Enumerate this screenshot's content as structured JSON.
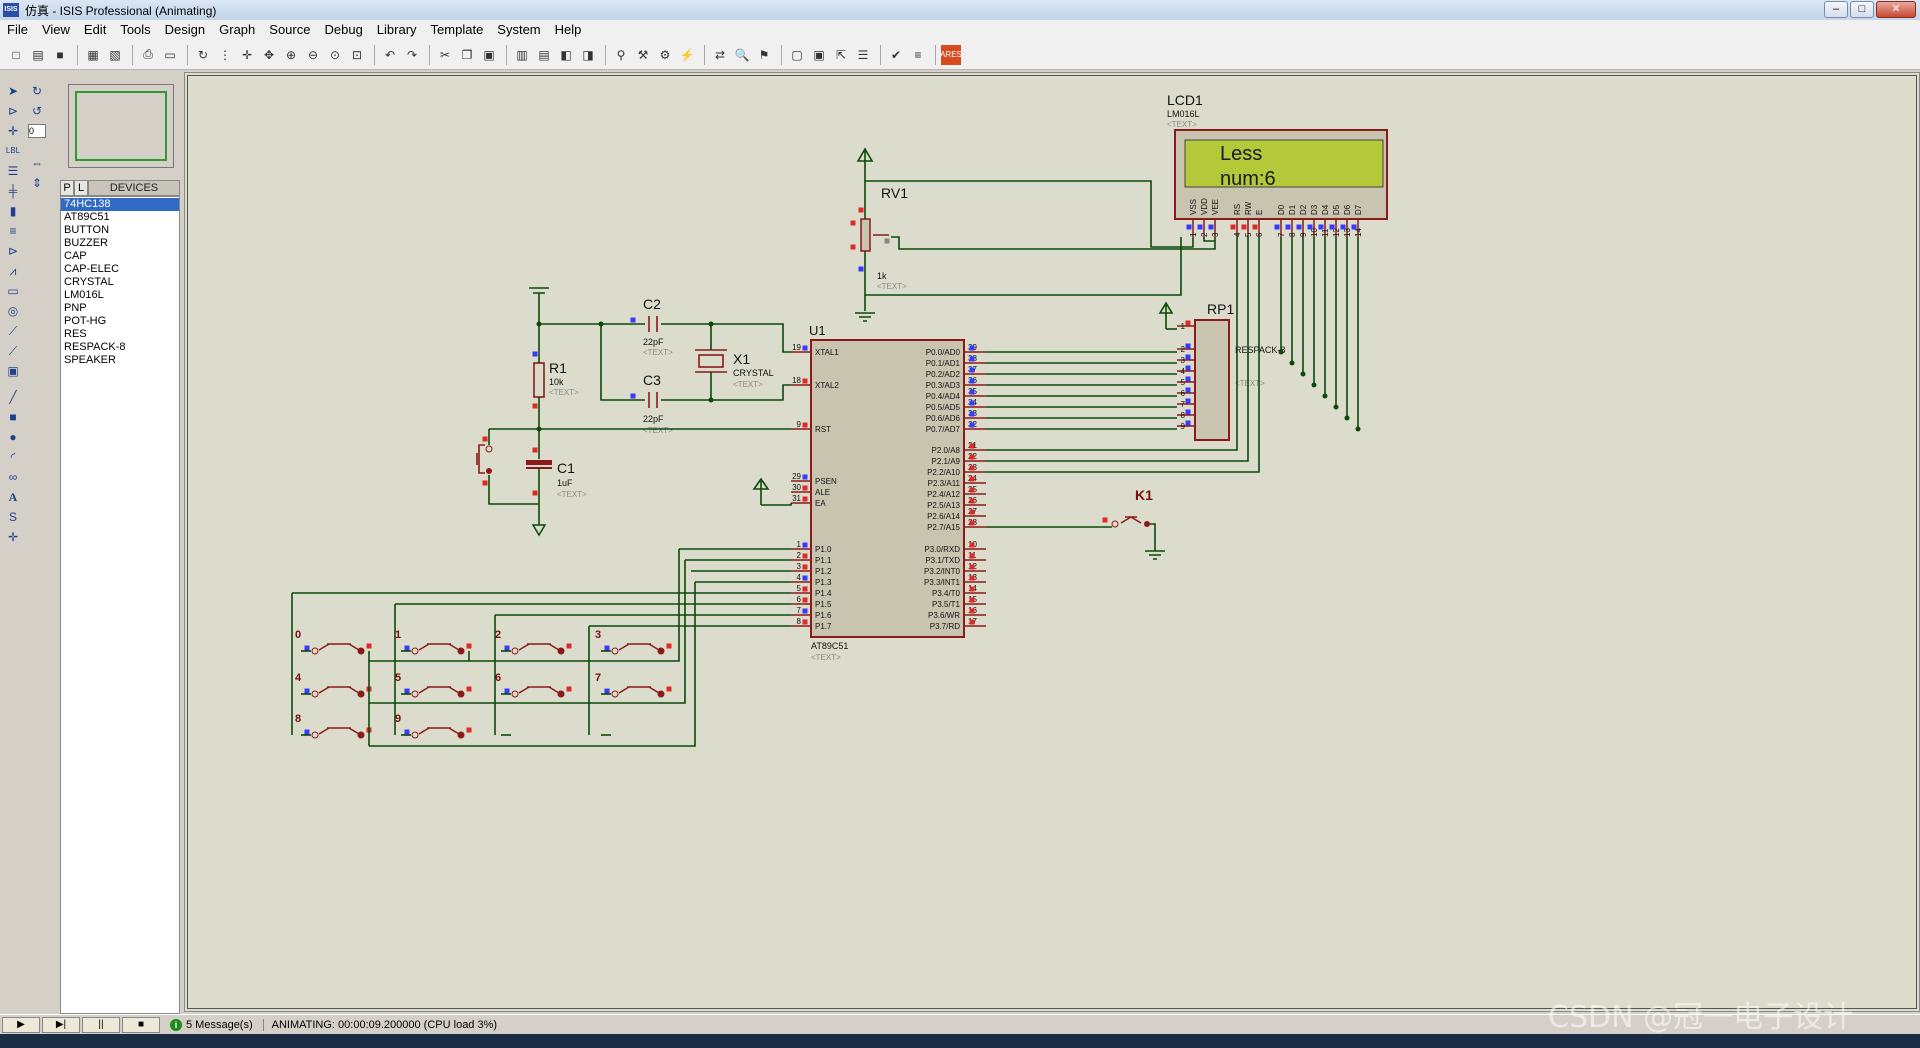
{
  "window": {
    "title": "仿真 - ISIS Professional (Animating)",
    "app_icon": "ISIS"
  },
  "menu": [
    "File",
    "View",
    "Edit",
    "Tools",
    "Design",
    "Graph",
    "Source",
    "Debug",
    "Library",
    "Template",
    "System",
    "Help"
  ],
  "device_panel": {
    "tab_p": "P",
    "tab_l": "L",
    "label": "DEVICES",
    "devices": [
      "74HC138",
      "AT89C51",
      "BUTTON",
      "BUZZER",
      "CAP",
      "CAP-ELEC",
      "CRYSTAL",
      "LM016L",
      "PNP",
      "POT-HG",
      "RES",
      "RESPACK-8",
      "SPEAKER"
    ],
    "selected": "74HC138",
    "rotation_value": "0"
  },
  "schematic": {
    "lcd": {
      "ref": "LCD1",
      "part": "LM016L",
      "text": "<TEXT>",
      "line1": "Less",
      "line2": "num:6",
      "pins": [
        "VSS",
        "VDD",
        "VEE",
        "RS",
        "RW",
        "E",
        "D0",
        "D1",
        "D2",
        "D3",
        "D4",
        "D5",
        "D6",
        "D7"
      ],
      "pin_numbers": [
        "1",
        "2",
        "3",
        "4",
        "5",
        "6",
        "7",
        "8",
        "9",
        "10",
        "11",
        "12",
        "13",
        "14"
      ]
    },
    "rv1": {
      "ref": "RV1",
      "value": "1k",
      "text": "<TEXT>"
    },
    "rp1": {
      "ref": "RP1",
      "part": "RESPACK-8",
      "text": "<TEXT>",
      "pins": [
        "1",
        "2",
        "3",
        "4",
        "5",
        "6",
        "7",
        "8",
        "9"
      ]
    },
    "u1": {
      "ref": "U1",
      "part": "AT89C51",
      "text": "<TEXT>",
      "left_pins": [
        [
          "19",
          "XTAL1"
        ],
        [
          "18",
          "XTAL2"
        ],
        [
          "9",
          "RST"
        ],
        [
          "29",
          "PSEN"
        ],
        [
          "30",
          "ALE"
        ],
        [
          "31",
          "EA"
        ],
        [
          "1",
          "P1.0"
        ],
        [
          "2",
          "P1.1"
        ],
        [
          "3",
          "P1.2"
        ],
        [
          "4",
          "P1.3"
        ],
        [
          "5",
          "P1.4"
        ],
        [
          "6",
          "P1.5"
        ],
        [
          "7",
          "P1.6"
        ],
        [
          "8",
          "P1.7"
        ]
      ],
      "right_pins": [
        [
          "39",
          "P0.0/AD0"
        ],
        [
          "38",
          "P0.1/AD1"
        ],
        [
          "37",
          "P0.2/AD2"
        ],
        [
          "36",
          "P0.3/AD3"
        ],
        [
          "35",
          "P0.4/AD4"
        ],
        [
          "34",
          "P0.5/AD5"
        ],
        [
          "33",
          "P0.6/AD6"
        ],
        [
          "32",
          "P0.7/AD7"
        ],
        [
          "21",
          "P2.0/A8"
        ],
        [
          "22",
          "P2.1/A9"
        ],
        [
          "23",
          "P2.2/A10"
        ],
        [
          "24",
          "P2.3/A11"
        ],
        [
          "25",
          "P2.4/A12"
        ],
        [
          "26",
          "P2.5/A13"
        ],
        [
          "27",
          "P2.6/A14"
        ],
        [
          "28",
          "P2.7/A15"
        ],
        [
          "10",
          "P3.0/RXD"
        ],
        [
          "11",
          "P3.1/TXD"
        ],
        [
          "12",
          "P3.2/INT0"
        ],
        [
          "13",
          "P3.3/INT1"
        ],
        [
          "14",
          "P3.4/T0"
        ],
        [
          "15",
          "P3.5/T1"
        ],
        [
          "16",
          "P3.6/WR"
        ],
        [
          "17",
          "P3.7/RD"
        ]
      ]
    },
    "c1": {
      "ref": "C1",
      "value": "1uF",
      "text": "<TEXT>"
    },
    "c2": {
      "ref": "C2",
      "value": "22pF",
      "text": "<TEXT>"
    },
    "c3": {
      "ref": "C3",
      "value": "22pF",
      "text": "<TEXT>"
    },
    "x1": {
      "ref": "X1",
      "part": "CRYSTAL",
      "text": "<TEXT>"
    },
    "r1": {
      "ref": "R1",
      "value": "10k",
      "text": "<TEXT>"
    },
    "k1": {
      "ref": "K1"
    },
    "keypad_labels": [
      "0",
      "1",
      "2",
      "3",
      "4",
      "5",
      "6",
      "7",
      "8",
      "9"
    ]
  },
  "status": {
    "play": "▶",
    "step": "▶|",
    "pause": "||",
    "stop": "■",
    "messages": "5 Message(s)",
    "animating": "ANIMATING: 00:00:09.200000 (CPU load 3%)"
  },
  "watermark": "CSDN @冠一电子设计"
}
